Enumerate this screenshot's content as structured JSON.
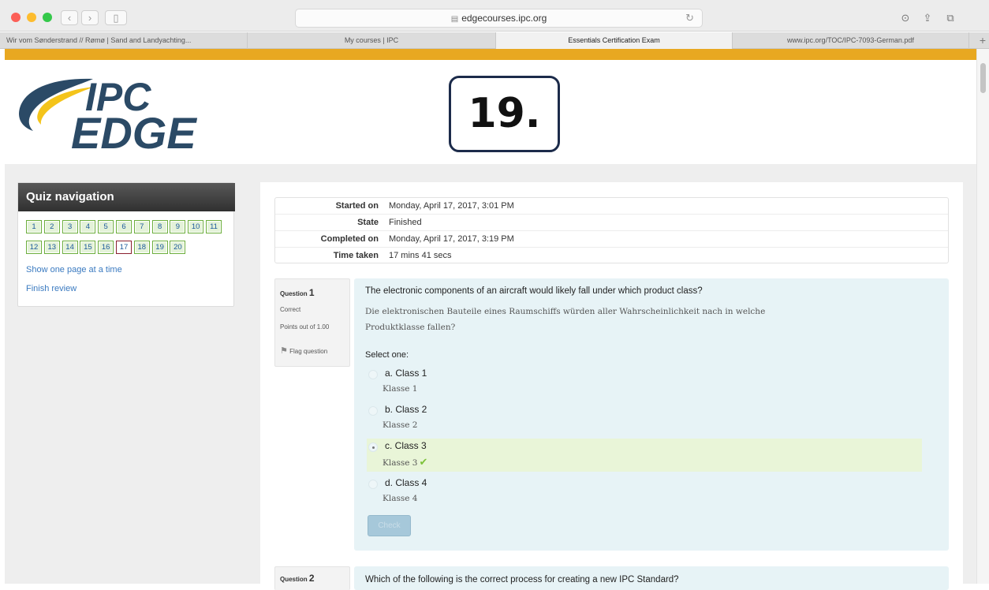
{
  "browser": {
    "url": "edgecourses.ipc.org",
    "tabs": [
      "Wir vom Sønderstrand // Rømø | Sand and Landyachting...",
      "My courses | IPC",
      "Essentials Certification Exam",
      "www.ipc.org/TOC/IPC-7093-German.pdf"
    ],
    "active_tab_index": 2
  },
  "header": {
    "logo_text_top": "IPC",
    "logo_text_bottom": "EDGE",
    "step_label": "19."
  },
  "quiz_nav": {
    "title": "Quiz navigation",
    "buttons": [
      "1",
      "2",
      "3",
      "4",
      "5",
      "6",
      "7",
      "8",
      "9",
      "10",
      "11",
      "12",
      "13",
      "14",
      "15",
      "16",
      "17",
      "18",
      "19",
      "20"
    ],
    "current": "17",
    "link_one_page": "Show one page at a time",
    "link_finish": "Finish review"
  },
  "summary": {
    "rows": [
      {
        "key": "Started on",
        "value": "Monday, April 17, 2017, 3:01 PM"
      },
      {
        "key": "State",
        "value": "Finished"
      },
      {
        "key": "Completed on",
        "value": "Monday, April 17, 2017, 3:19 PM"
      },
      {
        "key": "Time taken",
        "value": "17 mins 41 secs"
      }
    ]
  },
  "question1": {
    "label": "Question",
    "number": "1",
    "status": "Correct",
    "points": "Points out of 1.00",
    "flag": "Flag question",
    "text_en": "The electronic components of an aircraft would likely fall under which product class?",
    "text_de_line1": "Die elektronischen Bauteile eines Raumschiffs würden aller Wahrscheinlichkeit nach in welche",
    "text_de_line2": "Produktklasse fallen?",
    "select_one": "Select one:",
    "options": [
      {
        "label": "a. Class 1",
        "de": "Klasse 1"
      },
      {
        "label": "b. Class 2",
        "de": "Klasse 2"
      },
      {
        "label": "c. Class 3",
        "de": "Klasse 3"
      },
      {
        "label": "d. Class 4",
        "de": "Klasse 4"
      }
    ],
    "correct_option_index": 2,
    "check_button": "Check"
  },
  "question2": {
    "label": "Question",
    "number": "2",
    "text_en": "Which of the following is the correct process for creating a new IPC Standard?"
  },
  "colors": {
    "accent_bar": "#e8a821",
    "logo_blue": "#2b4a66",
    "logo_yellow": "#f4c41a",
    "correct_bg": "#e9f5d8",
    "question_bg": "#e7f3f6"
  }
}
